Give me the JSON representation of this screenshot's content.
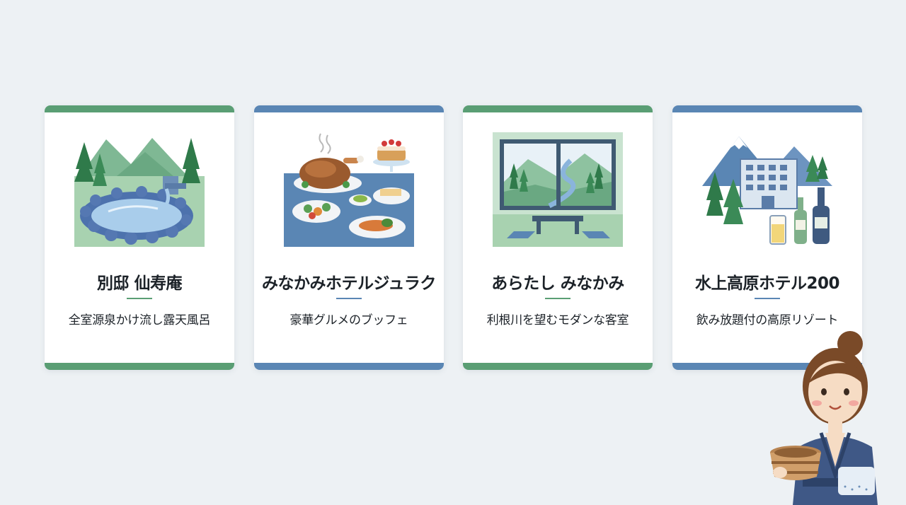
{
  "colors": {
    "green": "#5a9e74",
    "blue": "#5a86b4",
    "background": "#edf1f4"
  },
  "cards": [
    {
      "title": "別邸 仙寿庵",
      "subtitle": "全室源泉かけ流し露天風呂",
      "accent": "green",
      "illustration": "hot-spring-icon"
    },
    {
      "title": "みなかみホテルジュラク",
      "subtitle": "豪華グルメのブッフェ",
      "accent": "blue",
      "illustration": "buffet-icon"
    },
    {
      "title": "あらたし みなかみ",
      "subtitle": "利根川を望むモダンな客室",
      "accent": "green",
      "illustration": "river-view-room-icon"
    },
    {
      "title": "水上高原ホテル200",
      "subtitle": "飲み放題付の高原リゾート",
      "accent": "blue",
      "illustration": "highland-resort-icon"
    }
  ],
  "mascot": "yukata-woman-icon"
}
